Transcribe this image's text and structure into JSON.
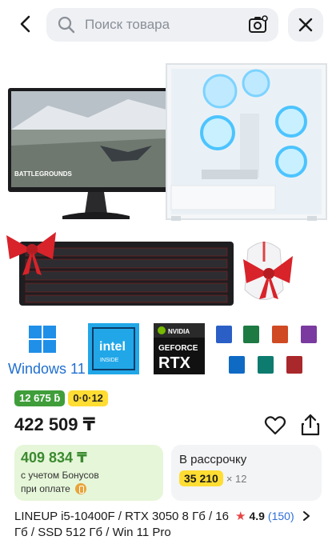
{
  "search": {
    "placeholder": "Поиск товара"
  },
  "badges": {
    "bonus": "12 675 ƃ",
    "installment": "0·0·12"
  },
  "price": "422 509 ₸",
  "bonus_card": {
    "price": "409 834 ₸",
    "line1": "с учетом Бонусов",
    "line2": "при оплате"
  },
  "installment_card": {
    "title": "В рассрочку",
    "amount": "35 210",
    "multiplier": "× 12"
  },
  "product": {
    "title": "LINEUP i5-10400F / RTX 3050 8 Гб / 16 Гб / SSD 512 Гб / Win 11 Pro",
    "rating": "4.9",
    "reviews": "(150)"
  },
  "image_labels": {
    "windows": "Windows 11",
    "intel_top": "intel",
    "intel_bottom": "INSIDE",
    "nvidia": "NVIDIA",
    "geforce": "GEFORCE",
    "rtx": "RTX",
    "battlegrounds": "BATTLEGROUNDS"
  },
  "colors": {
    "accent_green": "#3b8a2f",
    "yellow": "#ffdd33",
    "link": "#2f6fd8"
  }
}
